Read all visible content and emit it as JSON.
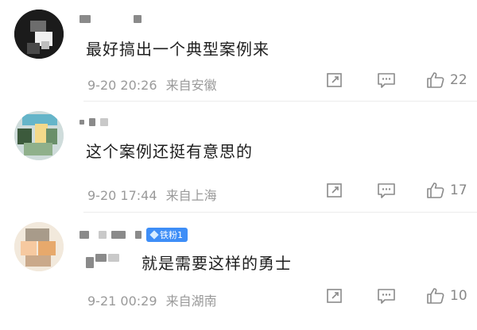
{
  "comments": [
    {
      "text": "最好搞出一个典型案例来",
      "date": "9-20 20:26",
      "location": "来自安徽",
      "likes": "22",
      "avatar_icon": "user-avatar-mosaic"
    },
    {
      "text": "这个案例还挺有意思的",
      "date": "9-20 17:44",
      "location": "来自上海",
      "likes": "17",
      "avatar_icon": "user-avatar-mosaic"
    },
    {
      "text": "就是需要这样的勇士",
      "date": "9-21 00:29",
      "location": "来自湖南",
      "likes": "10",
      "badge": "铁粉1",
      "avatar_icon": "user-avatar-mosaic"
    }
  ],
  "icons": {
    "forward": "forward-icon",
    "comment": "comment-icon",
    "like": "thumbs-up-icon"
  },
  "colors": {
    "badge": "#3e8ef7",
    "meta_text": "#9a9a9a",
    "icon": "#888888"
  }
}
